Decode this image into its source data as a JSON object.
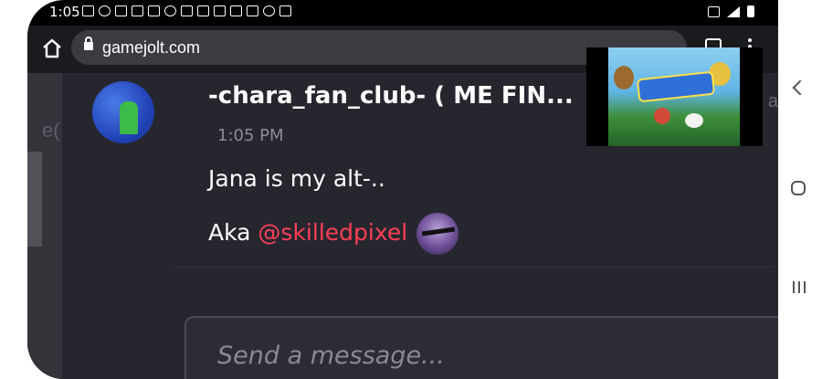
{
  "status_bar": {
    "time": "1:05",
    "left_icons": [
      "message-icon",
      "reddit-icon",
      "gmail-icon",
      "gmail-icon",
      "gmail-icon",
      "puzzle-icon",
      "calendar-icon",
      "calendar-icon",
      "calendar-icon",
      "tools-icon",
      "gmail-icon",
      "wifi-icon",
      "image-icon"
    ],
    "right_icons": [
      "vibrate-icon",
      "signal-icon",
      "battery-icon"
    ]
  },
  "browser": {
    "url": "gamejolt.com",
    "home_icon": "home-icon",
    "lock_icon": "lock-icon",
    "tabs_icon": "tabs-icon",
    "menu_icon": "overflow-menu-icon"
  },
  "left_panel": {
    "partial_text": "e("
  },
  "message": {
    "username": "-chara_fan_club- ( ME FIN...",
    "timestamp": "1:05 PM",
    "line1": "Jana is my alt-..",
    "line2_prefix": "Aka ",
    "mention": "@skilledpixel"
  },
  "right_cutoff_text": "a",
  "composer": {
    "placeholder": "Send a message..."
  },
  "colors": {
    "background": "#26262e",
    "mention": "#ff3e55",
    "timestamp": "#8c8c96"
  },
  "android_nav": {
    "back": "back-icon",
    "home": "home-circle-icon",
    "recents": "recents-icon"
  }
}
